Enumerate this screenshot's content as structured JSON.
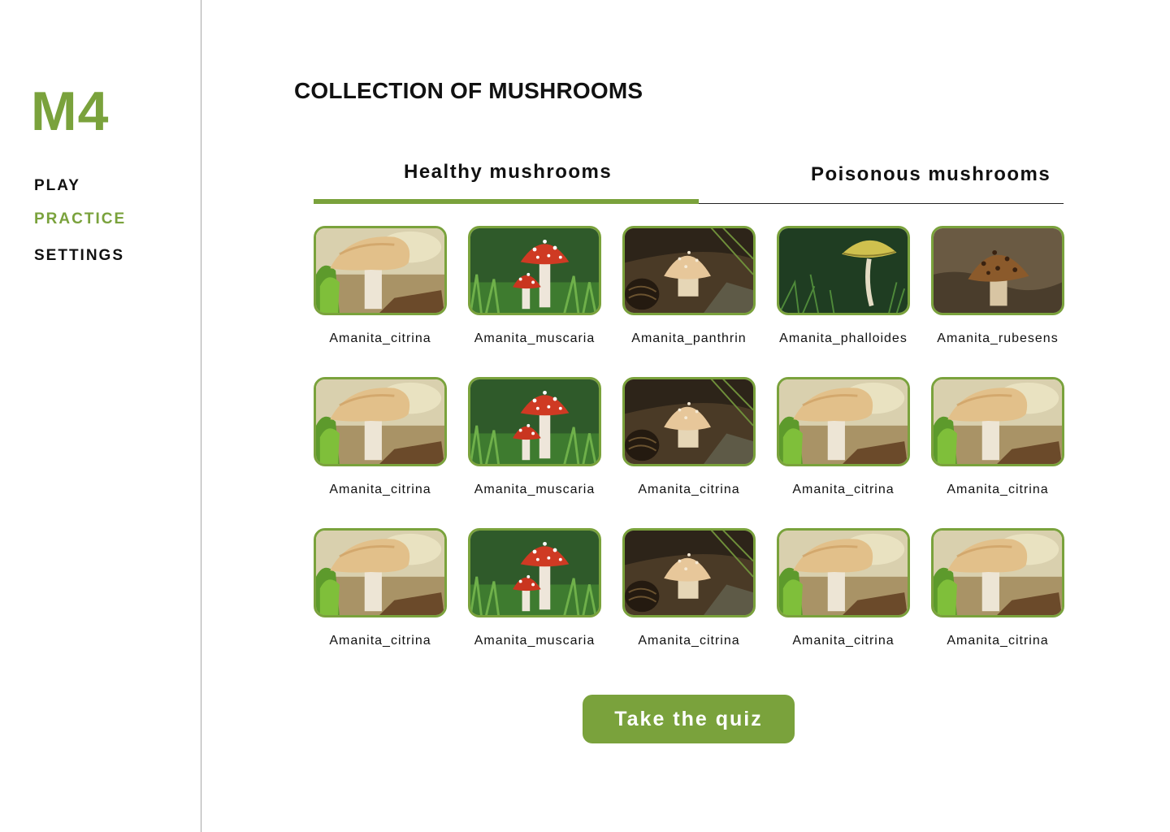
{
  "app": {
    "logo": "M4"
  },
  "nav": [
    {
      "label": "PLAY"
    },
    {
      "label": "PRACTICE",
      "active": true
    },
    {
      "label": "SETTINGS"
    }
  ],
  "page": {
    "title": "COLLECTION OF MUSHROOMS"
  },
  "tabs": [
    {
      "label": "Healthy mushrooms",
      "active": true
    },
    {
      "label": "Poisonous mushrooms",
      "active": false
    }
  ],
  "mushrooms": [
    {
      "name": "Amanita_citrina",
      "image": "pale-cap-mushroom"
    },
    {
      "name": "Amanita_muscaria",
      "image": "fly-agaric-mushroom"
    },
    {
      "name": "Amanita_panthrin",
      "image": "pinecone-mushroom"
    },
    {
      "name": "Amanita_phalloides",
      "image": "yellow-cap-mushroom"
    },
    {
      "name": "Amanita_rubesens",
      "image": "brown-spotted-mushroom"
    },
    {
      "name": "Amanita_citrina",
      "image": "pale-cap-mushroom"
    },
    {
      "name": "Amanita_muscaria",
      "image": "fly-agaric-mushroom"
    },
    {
      "name": "Amanita_citrina",
      "image": "pinecone-mushroom"
    },
    {
      "name": "Amanita_citrina",
      "image": "pale-cap-mushroom"
    },
    {
      "name": "Amanita_citrina",
      "image": "pale-cap-mushroom"
    },
    {
      "name": "Amanita_citrina",
      "image": "pale-cap-mushroom"
    },
    {
      "name": "Amanita_muscaria",
      "image": "fly-agaric-mushroom"
    },
    {
      "name": "Amanita_citrina",
      "image": "pinecone-mushroom"
    },
    {
      "name": "Amanita_citrina",
      "image": "pale-cap-mushroom"
    },
    {
      "name": "Amanita_citrina",
      "image": "pale-cap-mushroom"
    }
  ],
  "quiz_button": {
    "label": "Take the quiz"
  },
  "colors": {
    "accent": "#7aa23c",
    "text": "#111111",
    "background": "#ffffff"
  }
}
